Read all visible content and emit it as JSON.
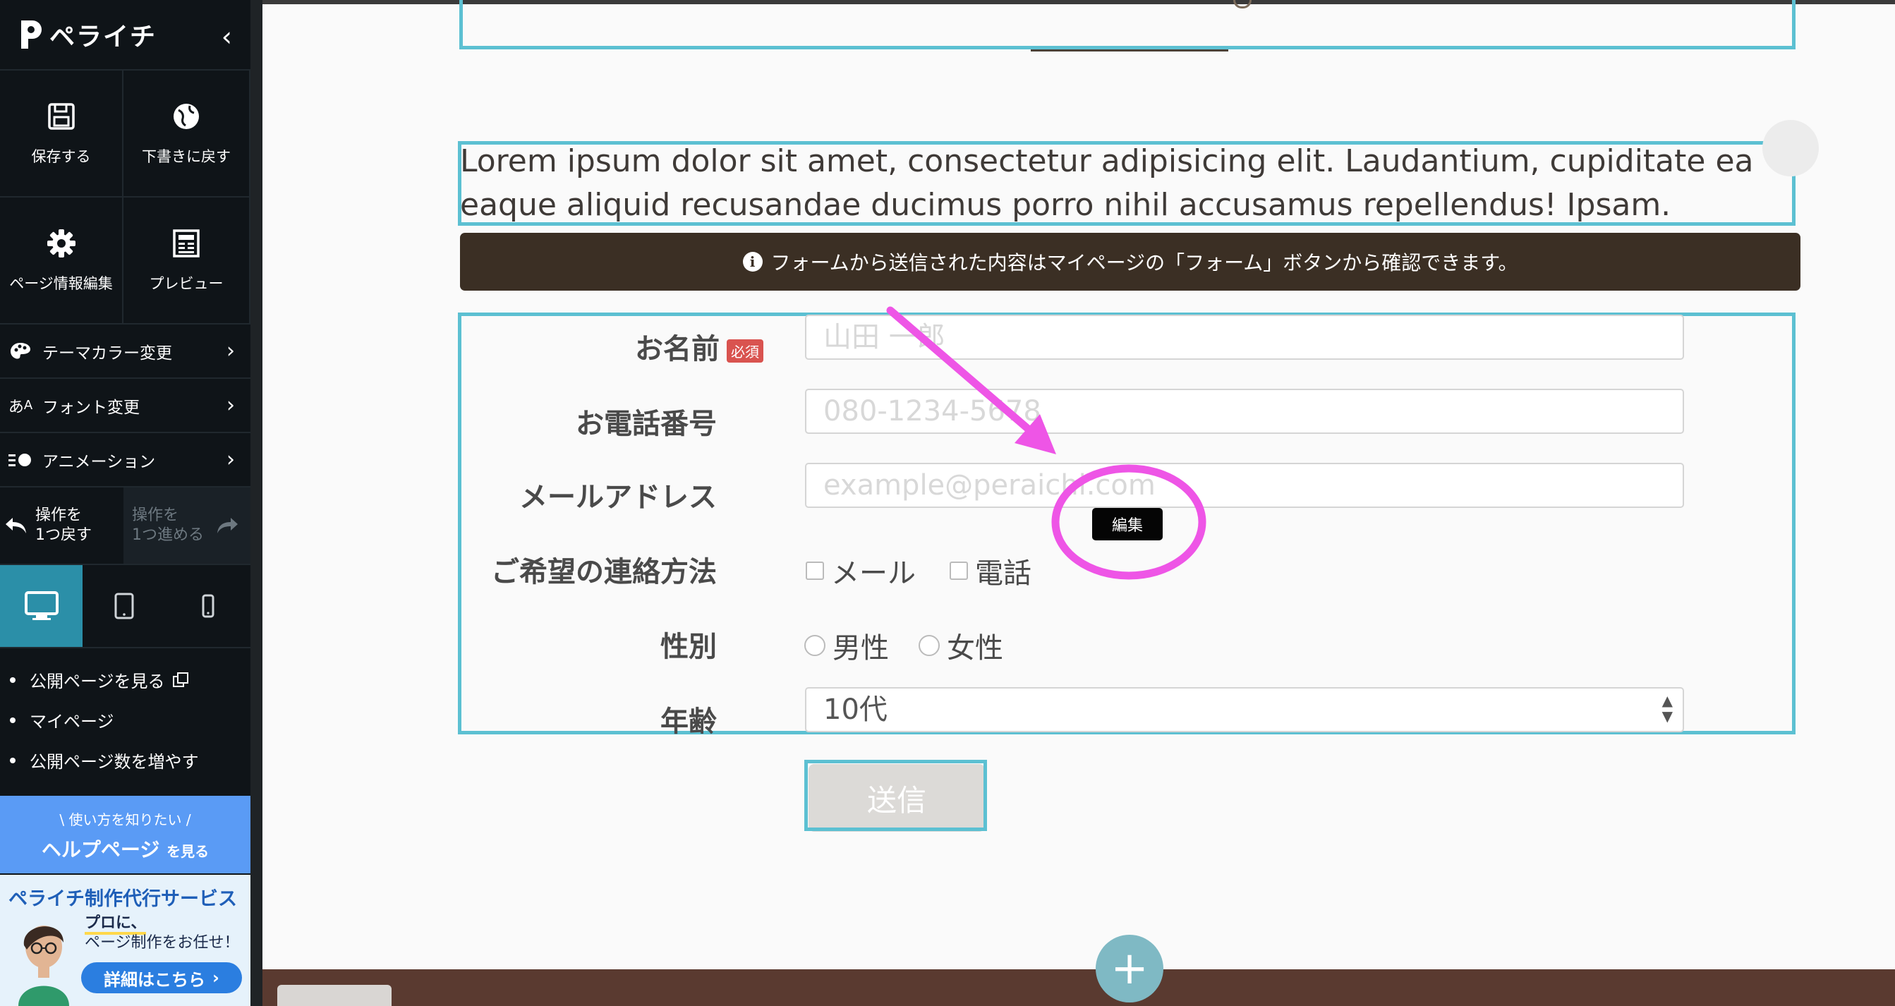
{
  "sidebar": {
    "logo_text": "ペライチ",
    "actions": {
      "save": "保存する",
      "revert": "下書きに戻す",
      "page_info": "ページ情報編集",
      "preview": "プレビュー"
    },
    "menu": {
      "theme_color": "テーマカラー変更",
      "font": "フォント変更",
      "animation": "アニメーション"
    },
    "undo": {
      "undo_l1": "操作を",
      "undo_l2": "1つ戻す",
      "redo_l1": "操作を",
      "redo_l2": "1つ進める"
    },
    "links": [
      "公開ページを見る",
      "マイページ",
      "公開ページ数を増やす"
    ],
    "help": {
      "line1": "\\ 使い方を知りたい /",
      "main": "ヘルプページ",
      "suffix": "を見る"
    },
    "promo": {
      "title": "ペライチ制作代行サービス",
      "line1": "プロに、",
      "line2": "ページ制作をお任せ！",
      "button": "詳細はこちら"
    }
  },
  "canvas": {
    "lorem_line1": "Lorem ipsum dolor sit amet, consectetur adipisicing elit. Laudantium, cupiditate ea",
    "lorem_line2": "eaque aliquid recusandae ducimus porro nihil accusamus repellendus! Ipsam.",
    "notice": "フォームから送信された内容はマイページの「フォーム」ボタンから確認できます。",
    "form": {
      "name_label": "お名前",
      "required_badge": "必須",
      "name_placeholder": "山田 一郎",
      "phone_label": "お電話番号",
      "phone_placeholder": "080-1234-5678",
      "email_label": "メールアドレス",
      "email_placeholder": "example@peraichi.com",
      "contact_label": "ご希望の連絡方法",
      "contact_options": [
        "メール",
        "電話"
      ],
      "gender_label": "性別",
      "gender_options": [
        "男性",
        "女性"
      ],
      "age_label": "年齢",
      "age_value": "10代",
      "submit": "送信"
    },
    "edit_button": "編集",
    "add_section": "+"
  },
  "colors": {
    "accent_teal": "#5cc0d2",
    "annotation_magenta": "#ee55e6",
    "notice_bg": "#3b2f24",
    "required_red": "#d9534f"
  }
}
